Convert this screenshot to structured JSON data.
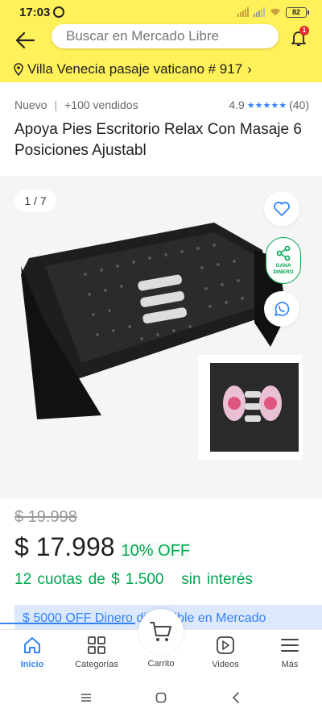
{
  "status_bar": {
    "time": "17:03",
    "battery": "82"
  },
  "header": {
    "search_placeholder": "Buscar en Mercado Libre",
    "notification_count": "1"
  },
  "address": {
    "text": "Villa Venecia pasaje vaticano # 917",
    "chevron": "›"
  },
  "product": {
    "condition": "Nuevo",
    "separator": "|",
    "sold": "+100 vendidos",
    "rating": "4.9",
    "stars": "★★★★★",
    "reviews": "(40)",
    "title": "Apoya Pies Escritorio Relax Con Masaje 6 Posiciones Ajustabl"
  },
  "gallery": {
    "counter": "1 / 7",
    "share_label": "GANA DINERO"
  },
  "pricing": {
    "old_price": "$ 19.998",
    "price": "$ 17.998",
    "discount": "10% OFF",
    "installments": "12 cuotas de $ 1.500   sin interés",
    "promo": "$ 5000 OFF Dinero disponible en Mercado"
  },
  "bottom_nav": {
    "items": [
      {
        "label": "Inicio"
      },
      {
        "label": "Categorías"
      },
      {
        "label": "Carrito"
      },
      {
        "label": "Videos"
      },
      {
        "label": "Más"
      }
    ]
  },
  "colors": {
    "brand_yellow": "#fff159",
    "accent_blue": "#3483fa",
    "success_green": "#00a650"
  }
}
